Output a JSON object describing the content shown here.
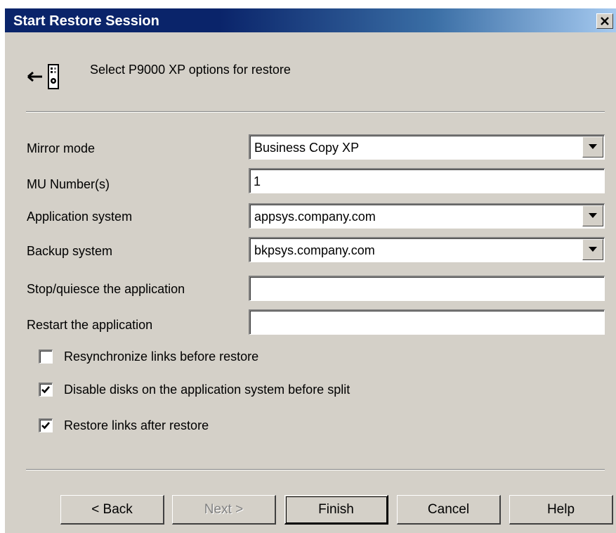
{
  "window": {
    "title": "Start Restore Session",
    "close_label": "×"
  },
  "header": {
    "icon": "restore-device-icon",
    "text": "Select P9000 XP options for restore"
  },
  "form": {
    "mirror_mode": {
      "label": "Mirror mode",
      "value": "Business Copy XP"
    },
    "mu_numbers": {
      "label": "MU Number(s)",
      "value": "1"
    },
    "application_system": {
      "label": "Application system",
      "value": "appsys.company.com"
    },
    "backup_system": {
      "label": "Backup system",
      "value": "bkpsys.company.com"
    },
    "stop_quiesce": {
      "label": "Stop/quiesce the application",
      "value": ""
    },
    "restart": {
      "label": "Restart the application",
      "value": ""
    }
  },
  "checkboxes": {
    "resync": {
      "label": "Resynchronize links before restore",
      "checked": false
    },
    "disable_disks": {
      "label": "Disable disks on the application system before split",
      "checked": true
    },
    "restore_links": {
      "label": "Restore links after restore",
      "checked": true
    }
  },
  "buttons": {
    "back": "< Back",
    "next": "Next >",
    "finish": "Finish",
    "cancel": "Cancel",
    "help": "Help"
  }
}
